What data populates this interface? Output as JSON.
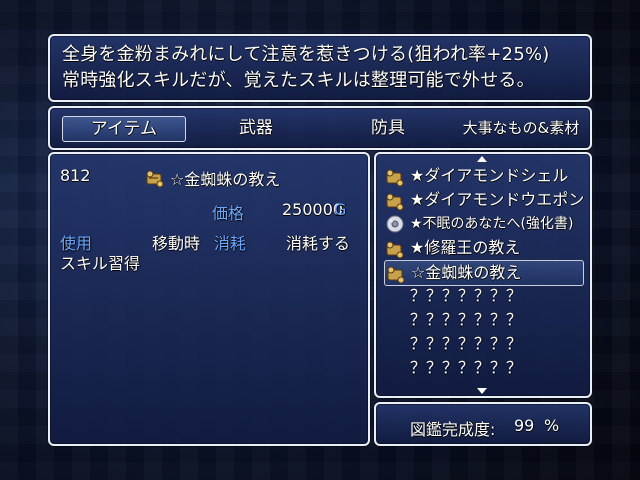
{
  "help": {
    "line1": "全身を金粉まみれにして注意を惹きつける(狙われ率+25%)",
    "line2": "常時強化スキルだが、覚えたスキルは整理可能で外せる。"
  },
  "categories": [
    {
      "label": "アイテム",
      "selected": true
    },
    {
      "label": "武器",
      "selected": false
    },
    {
      "label": "防具",
      "selected": false
    },
    {
      "label": "大事なもの&素材",
      "selected": false
    }
  ],
  "detail": {
    "id": "812",
    "name": "☆金蜘蛛の教え",
    "price_label": "価格",
    "price_value": "250000",
    "currency": "G",
    "use_label": "使用",
    "use_value": "移動時",
    "consume_label": "消耗",
    "consume_value": "消耗する",
    "effect": "スキル習得"
  },
  "list": {
    "items": [
      {
        "label": "★ダイアモンドシェル",
        "icon": "scroll-icon"
      },
      {
        "label": "★ダイアモンドウエポン",
        "icon": "scroll-icon"
      },
      {
        "label": "★不眠のあなたへ(強化書)",
        "icon": "disc-icon"
      },
      {
        "label": "★修羅王の教え",
        "icon": "scroll-icon"
      },
      {
        "label": "☆金蜘蛛の教え",
        "icon": "scroll-icon",
        "selected": true
      },
      {
        "label": "？？？？？？？",
        "icon": ""
      },
      {
        "label": "？？？？？？？",
        "icon": ""
      },
      {
        "label": "？？？？？？？",
        "icon": ""
      },
      {
        "label": "？？？？？？？",
        "icon": ""
      }
    ]
  },
  "dex": {
    "label": "図鑑完成度:",
    "value": "99",
    "unit": "%"
  },
  "colors": {
    "window_top": "#24366c",
    "window_bottom": "#121c42",
    "system_text": "#6aa8ff"
  }
}
